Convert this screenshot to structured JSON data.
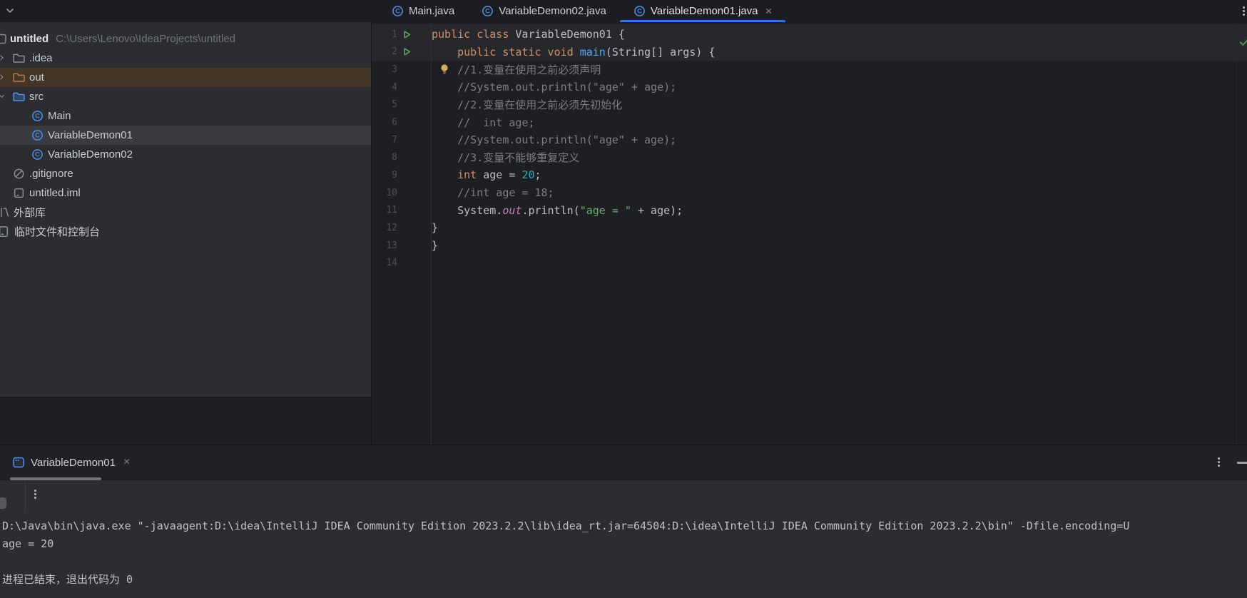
{
  "colors": {
    "accent": "#3574F0",
    "keyword": "#CF8E6D",
    "method": "#56A8F5",
    "number": "#2AACB8",
    "string": "#6AAB73",
    "field": "#C77DBB",
    "comment": "#7A7E85",
    "plain": "#BCBEC4",
    "excluded_row": "#443627",
    "selected_row": "#393B40"
  },
  "editor_tabs": [
    {
      "label": "Main.java",
      "active": false,
      "closable": false
    },
    {
      "label": "VariableDemon02.java",
      "active": false,
      "closable": false
    },
    {
      "label": "VariableDemon01.java",
      "active": true,
      "closable": true
    }
  ],
  "project": {
    "root_name": "untitled",
    "root_path": "C:\\Users\\Lenovo\\IdeaProjects\\untitled",
    "items": [
      {
        "label": ".idea",
        "icon": "folder",
        "color": "gray",
        "indent": 1,
        "chevron": "collapsed"
      },
      {
        "label": "out",
        "icon": "folder",
        "color": "orange",
        "indent": 1,
        "chevron": "collapsed",
        "highlight": "excl"
      },
      {
        "label": "src",
        "icon": "folder",
        "color": "blue",
        "indent": 1,
        "chevron": "expanded"
      },
      {
        "label": "Main",
        "icon": "class",
        "indent": 2
      },
      {
        "label": "VariableDemon01",
        "icon": "class",
        "indent": 2,
        "highlight": "sel"
      },
      {
        "label": "VariableDemon02",
        "icon": "class",
        "indent": 2
      },
      {
        "label": ".gitignore",
        "icon": "ignored",
        "indent": 1
      },
      {
        "label": "untitled.iml",
        "icon": "file",
        "indent": 1
      },
      {
        "label": "外部库",
        "icon": "library",
        "indent": 0
      },
      {
        "label": "临时文件和控制台",
        "icon": "scratch",
        "indent": 0
      }
    ]
  },
  "editor": {
    "lines": [
      {
        "num": "1",
        "run": true,
        "seg": [
          [
            "public class",
            "kw"
          ],
          [
            " VariableDemon01 {",
            "pl"
          ]
        ]
      },
      {
        "num": "2",
        "run": true,
        "seg": [
          [
            "    ",
            "pl"
          ],
          [
            "public static void",
            "kw"
          ],
          [
            " ",
            "pl"
          ],
          [
            "main",
            "fn"
          ],
          [
            "(String[] args) {",
            "pl"
          ]
        ]
      },
      {
        "num": "3",
        "bulb": true,
        "seg": [
          [
            "    ",
            "pl"
          ],
          [
            "//1.变量在使用之前必须声明",
            "cm"
          ]
        ]
      },
      {
        "num": "4",
        "seg": [
          [
            "    ",
            "pl"
          ],
          [
            "//System.out.println(\"age\" + age);",
            "cm"
          ]
        ]
      },
      {
        "num": "5",
        "seg": [
          [
            "    ",
            "pl"
          ],
          [
            "//2.变量在使用之前必须先初始化",
            "cm"
          ]
        ]
      },
      {
        "num": "6",
        "seg": [
          [
            "    ",
            "pl"
          ],
          [
            "//  int age;",
            "cm"
          ]
        ]
      },
      {
        "num": "7",
        "seg": [
          [
            "    ",
            "pl"
          ],
          [
            "//System.out.println(\"age\" + age);",
            "cm"
          ]
        ]
      },
      {
        "num": "8",
        "seg": [
          [
            "    ",
            "pl"
          ],
          [
            "//3.变量不能够重复定义",
            "cm"
          ]
        ]
      },
      {
        "num": "9",
        "seg": [
          [
            "    ",
            "pl"
          ],
          [
            "int",
            "kw"
          ],
          [
            " age = ",
            "pl"
          ],
          [
            "20",
            "num"
          ],
          [
            ";",
            "pl"
          ]
        ]
      },
      {
        "num": "10",
        "seg": [
          [
            "    ",
            "pl"
          ],
          [
            "//int age = 18;",
            "cm"
          ]
        ]
      },
      {
        "num": "11",
        "seg": [
          [
            "    ",
            "pl"
          ],
          [
            "System.",
            "pl"
          ],
          [
            "out",
            "fd"
          ],
          [
            ".println(",
            "pl"
          ],
          [
            "\"age = \"",
            "st"
          ],
          [
            " + age);",
            "pl"
          ]
        ]
      },
      {
        "num": "12",
        "seg": [
          [
            "}",
            "pl"
          ]
        ]
      },
      {
        "num": "13",
        "seg": [
          [
            "}",
            "pl"
          ]
        ]
      },
      {
        "num": "14",
        "seg": []
      }
    ]
  },
  "bottom": {
    "tab_label": "VariableDemon01",
    "console_lines": [
      "D:\\Java\\bin\\java.exe \"-javaagent:D:\\idea\\IntelliJ IDEA Community Edition 2023.2.2\\lib\\idea_rt.jar=64504:D:\\idea\\IntelliJ IDEA Community Edition 2023.2.2\\bin\" -Dfile.encoding=U",
      "age = 20",
      "",
      "进程已结束，退出代码为 0"
    ]
  }
}
